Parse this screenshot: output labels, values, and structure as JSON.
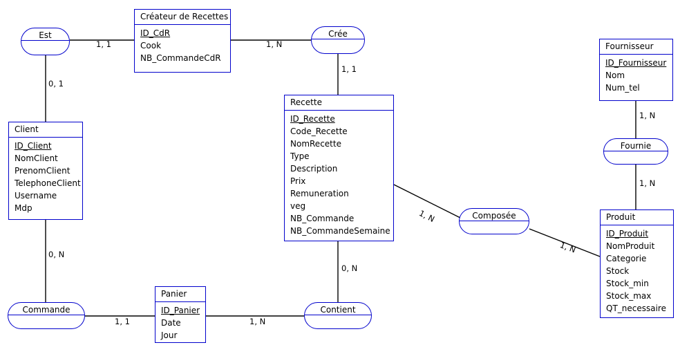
{
  "diagram": {
    "title": "Entity-Relationship Diagram",
    "colors": {
      "shape_border": "#0000cc",
      "line": "#000000",
      "text": "#000000",
      "background": "#ffffff"
    },
    "entities": [
      {
        "id": "createur",
        "name": "Créateur de Recettes",
        "attributes": [
          {
            "label": "ID_CdR",
            "key": true
          },
          {
            "label": "Cook",
            "key": false
          },
          {
            "label": "NB_CommandeCdR",
            "key": false
          }
        ]
      },
      {
        "id": "client",
        "name": "Client",
        "attributes": [
          {
            "label": "ID_Client",
            "key": true
          },
          {
            "label": "NomClient",
            "key": false
          },
          {
            "label": "PrenomClient",
            "key": false
          },
          {
            "label": "TelephoneClient",
            "key": false
          },
          {
            "label": "Username",
            "key": false
          },
          {
            "label": "Mdp",
            "key": false
          }
        ]
      },
      {
        "id": "recette",
        "name": "Recette",
        "attributes": [
          {
            "label": "ID_Recette",
            "key": true
          },
          {
            "label": "Code_Recette",
            "key": false
          },
          {
            "label": "NomRecette",
            "key": false
          },
          {
            "label": "Type",
            "key": false
          },
          {
            "label": "Description",
            "key": false
          },
          {
            "label": "Prix",
            "key": false
          },
          {
            "label": "Remuneration",
            "key": false
          },
          {
            "label": "veg",
            "key": false
          },
          {
            "label": "NB_Commande",
            "key": false
          },
          {
            "label": "NB_CommandeSemaine",
            "key": false
          }
        ]
      },
      {
        "id": "fournisseur",
        "name": "Fournisseur",
        "attributes": [
          {
            "label": "ID_Fournisseur",
            "key": true
          },
          {
            "label": "Nom",
            "key": false
          },
          {
            "label": "Num_tel",
            "key": false
          }
        ]
      },
      {
        "id": "produit",
        "name": "Produit",
        "attributes": [
          {
            "label": "ID_Produit",
            "key": true
          },
          {
            "label": "NomProduit",
            "key": false
          },
          {
            "label": "Categorie",
            "key": false
          },
          {
            "label": "Stock",
            "key": false
          },
          {
            "label": "Stock_min",
            "key": false
          },
          {
            "label": "Stock_max",
            "key": false
          },
          {
            "label": "QT_necessaire",
            "key": false
          }
        ]
      },
      {
        "id": "panier",
        "name": "Panier",
        "attributes": [
          {
            "label": "ID_Panier",
            "key": true
          },
          {
            "label": "Date",
            "key": false
          },
          {
            "label": "Jour",
            "key": false
          }
        ]
      }
    ],
    "relationships": [
      {
        "id": "est",
        "name": "Est"
      },
      {
        "id": "cree",
        "name": "Crée"
      },
      {
        "id": "fournie",
        "name": "Fournie"
      },
      {
        "id": "composee",
        "name": "Composée"
      },
      {
        "id": "commande",
        "name": "Commande"
      },
      {
        "id": "contient",
        "name": "Contient"
      }
    ],
    "cardinalities": [
      {
        "id": "est-createur",
        "label": "1, 1"
      },
      {
        "id": "est-client",
        "label": "0, 1"
      },
      {
        "id": "createur-cree",
        "label": "1, N"
      },
      {
        "id": "cree-recette",
        "label": "1, 1"
      },
      {
        "id": "client-commande",
        "label": "0, N"
      },
      {
        "id": "commande-panier",
        "label": "1, 1"
      },
      {
        "id": "panier-contient",
        "label": "1, N"
      },
      {
        "id": "recette-contient",
        "label": "0, N"
      },
      {
        "id": "recette-composee",
        "label": "1, N"
      },
      {
        "id": "composee-produit",
        "label": "1, N"
      },
      {
        "id": "fournisseur-fournie",
        "label": "1, N"
      },
      {
        "id": "fournie-produit",
        "label": "1, N"
      }
    ]
  }
}
